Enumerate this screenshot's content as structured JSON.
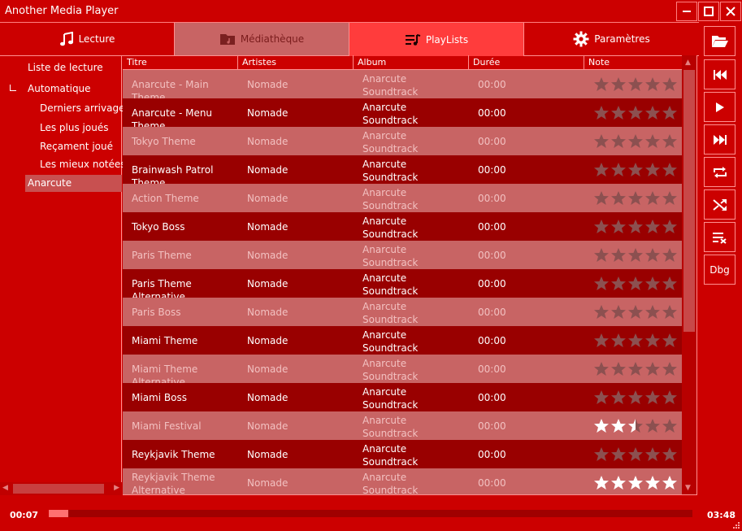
{
  "app": {
    "title": "Another Media Player"
  },
  "tabs": [
    {
      "label": "Lecture",
      "icon": "music-note-icon"
    },
    {
      "label": "Médiathèque",
      "icon": "folder-music-icon"
    },
    {
      "label": "PlayLists",
      "icon": "playlist-icon",
      "active": true
    },
    {
      "label": "Paramètres",
      "icon": "gear-icon"
    }
  ],
  "sidebar": {
    "header": "Liste de lecture",
    "root": "Automatique",
    "items": [
      "Derniers arrivages",
      "Les plus joués",
      "Reçament joué",
      "Les mieux notées"
    ],
    "selected": "Anarcute"
  },
  "grid": {
    "columns": [
      "Titre",
      "Artistes",
      "Album",
      "Durée",
      "Note"
    ],
    "rows": [
      {
        "title": "Anarcute - Main Theme",
        "artist": "Nomade",
        "album": "Anarcute Soundtrack",
        "duration": "00:00",
        "rating": 0
      },
      {
        "title": "Anarcute - Menu Theme",
        "artist": "Nomade",
        "album": "Anarcute Soundtrack",
        "duration": "00:00",
        "rating": 0
      },
      {
        "title": "Tokyo Theme",
        "artist": "Nomade",
        "album": "Anarcute Soundtrack",
        "duration": "00:00",
        "rating": 0
      },
      {
        "title": "Brainwash Patrol Theme",
        "artist": "Nomade",
        "album": "Anarcute Soundtrack",
        "duration": "00:00",
        "rating": 0
      },
      {
        "title": "Action Theme",
        "artist": "Nomade",
        "album": "Anarcute Soundtrack",
        "duration": "00:00",
        "rating": 0
      },
      {
        "title": "Tokyo Boss",
        "artist": "Nomade",
        "album": "Anarcute Soundtrack",
        "duration": "00:00",
        "rating": 0
      },
      {
        "title": "Paris Theme",
        "artist": "Nomade",
        "album": "Anarcute Soundtrack",
        "duration": "00:00",
        "rating": 0
      },
      {
        "title": "Paris Theme Alternative",
        "artist": "Nomade",
        "album": "Anarcute Soundtrack",
        "duration": "00:00",
        "rating": 0
      },
      {
        "title": "Paris Boss",
        "artist": "Nomade",
        "album": "Anarcute Soundtrack",
        "duration": "00:00",
        "rating": 0
      },
      {
        "title": "Miami Theme",
        "artist": "Nomade",
        "album": "Anarcute Soundtrack",
        "duration": "00:00",
        "rating": 0
      },
      {
        "title": "Miami Theme Alternative",
        "artist": "Nomade",
        "album": "Anarcute Soundtrack",
        "duration": "00:00",
        "rating": 0
      },
      {
        "title": "Miami Boss",
        "artist": "Nomade",
        "album": "Anarcute Soundtrack",
        "duration": "00:00",
        "rating": 0
      },
      {
        "title": "Miami Festival",
        "artist": "Nomade",
        "album": "Anarcute Soundtrack",
        "duration": "00:00",
        "rating": 2.5
      },
      {
        "title": "Reykjavik Theme",
        "artist": "Nomade",
        "album": "Anarcute Soundtrack",
        "duration": "00:00",
        "rating": 0
      },
      {
        "title": "Reykjavik Theme Alternative",
        "artist": "Nomade",
        "album": "Anarcute Soundtrack",
        "duration": "00:00",
        "rating": 5
      }
    ]
  },
  "toolbar": [
    {
      "name": "open-folder-button",
      "icon": "folder-open-icon"
    },
    {
      "name": "previous-button",
      "icon": "skip-previous-icon"
    },
    {
      "name": "play-button",
      "icon": "play-icon"
    },
    {
      "name": "next-button",
      "icon": "skip-next-icon"
    },
    {
      "name": "repeat-button",
      "icon": "repeat-icon"
    },
    {
      "name": "shuffle-button",
      "icon": "shuffle-icon"
    },
    {
      "name": "clear-playlist-button",
      "icon": "clear-list-icon"
    },
    {
      "name": "debug-button",
      "label": "Dbg"
    }
  ],
  "player": {
    "elapsed": "00:07",
    "total": "03:48",
    "progress": 0.03
  },
  "colors": {
    "background": "#cc0000",
    "row_light": "#c86464",
    "row_dark": "#990000",
    "active_tab": "#ff3c3c",
    "progress_fill": "#ff7070"
  }
}
